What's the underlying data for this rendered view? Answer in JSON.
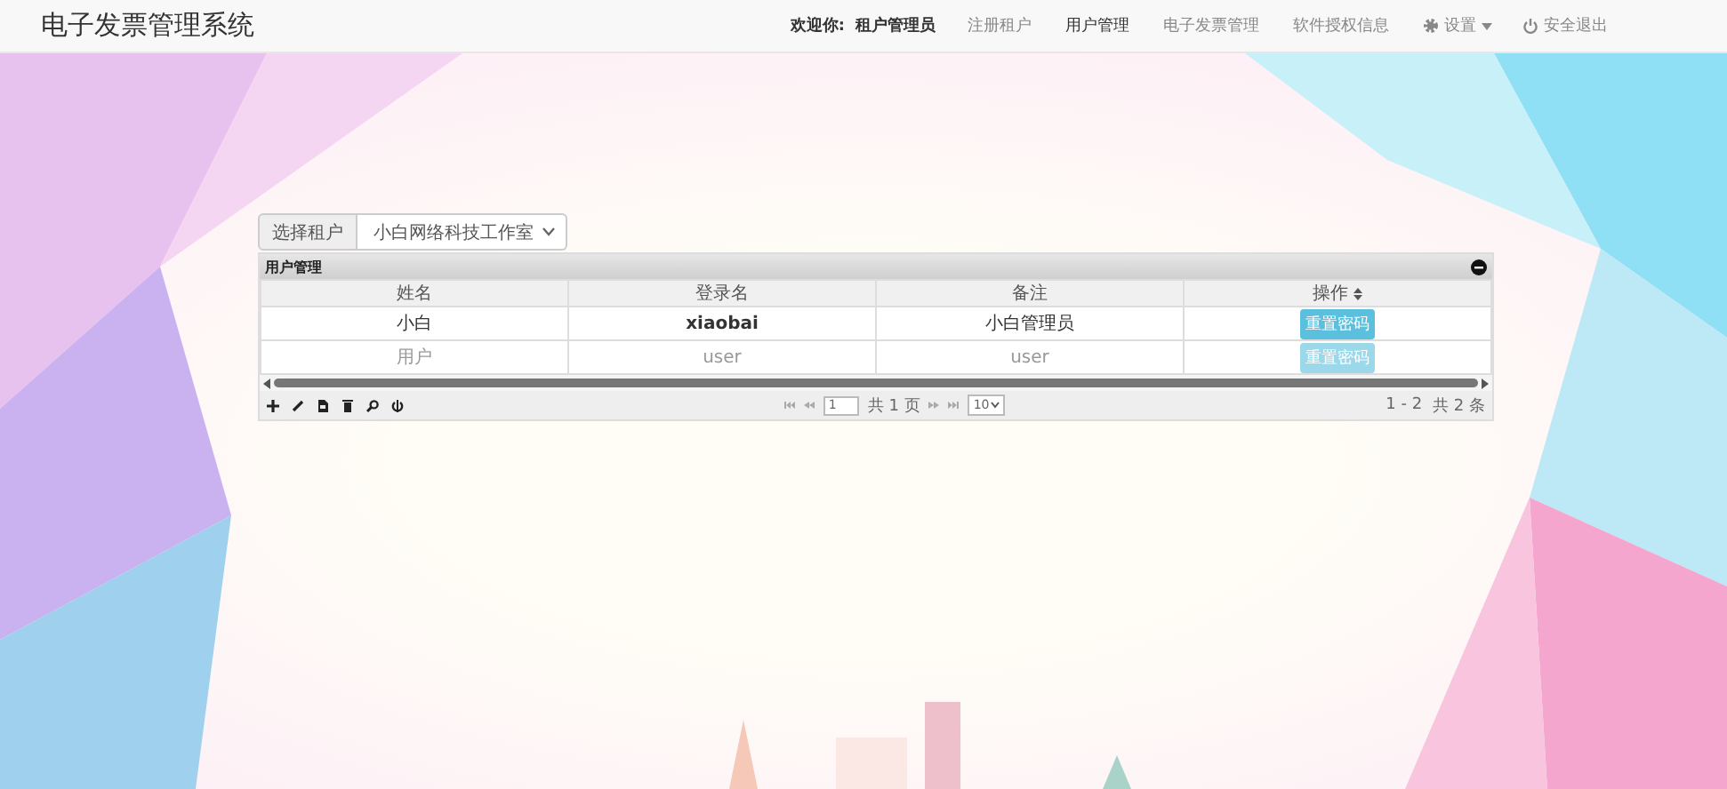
{
  "window": {
    "title": "电子发票管理系统"
  },
  "nav": {
    "greeting": "欢迎你:",
    "user": "租户管理员",
    "items": [
      {
        "label": "注册租户",
        "selected": false
      },
      {
        "label": "用户管理",
        "selected": true
      },
      {
        "label": "电子发票管理",
        "selected": false
      },
      {
        "label": "软件授权信息",
        "selected": false
      }
    ],
    "settings": {
      "label": "设置"
    },
    "logout": {
      "label": "安全退出"
    }
  },
  "tenant_select": {
    "label": "选择租户",
    "value": "小白网络科技工作室"
  },
  "grid": {
    "title": "用户管理",
    "columns": [
      "姓名",
      "登录名",
      "备注",
      "操作"
    ],
    "rows": [
      {
        "cells": [
          "小白",
          "xiaobai",
          "小白管理员"
        ],
        "action": "重置密码",
        "disabled": false
      },
      {
        "cells": [
          "用户",
          "user",
          "user"
        ],
        "action": "重置密码",
        "disabled": true
      }
    ],
    "pager": {
      "page": "1",
      "total_pages": "共 1 页",
      "page_size": "10",
      "range": "1 - 2",
      "total": "共 2 条"
    }
  }
}
